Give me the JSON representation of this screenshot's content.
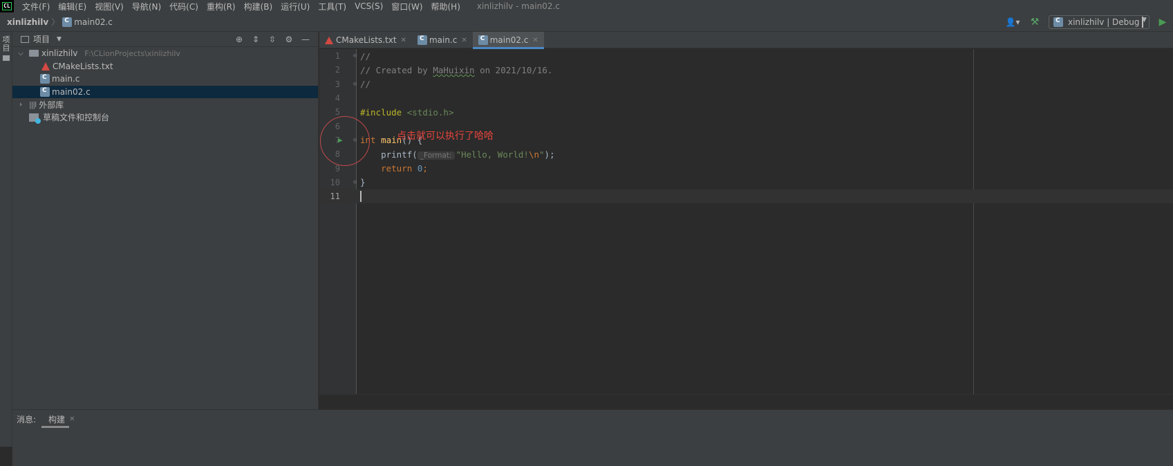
{
  "app": {
    "logo": "CL",
    "window_title": "xinlizhilv - main02.c"
  },
  "menu": [
    "文件(F)",
    "编辑(E)",
    "视图(V)",
    "导航(N)",
    "代码(C)",
    "重构(R)",
    "构建(B)",
    "运行(U)",
    "工具(T)",
    "VCS(S)",
    "窗口(W)",
    "帮助(H)"
  ],
  "breadcrumb": {
    "project": "xinlizhilv",
    "file": "main02.c"
  },
  "toolbar": {
    "config_label": "xinlizhilv | Debug",
    "icons": [
      "user-icon",
      "hammer-icon",
      "run-icon"
    ]
  },
  "toolstrip": {
    "project_tab": "项目"
  },
  "project_panel": {
    "title": "项目",
    "tree": [
      {
        "label": "xinlizhilv",
        "path": "F:\\CLionProjects\\xinlizhilv"
      },
      {
        "label": "CMakeLists.txt"
      },
      {
        "label": "main.c"
      },
      {
        "label": "main02.c"
      },
      {
        "label": "外部库"
      },
      {
        "label": "草稿文件和控制台"
      }
    ]
  },
  "tabs": [
    {
      "label": "CMakeLists.txt"
    },
    {
      "label": "main.c"
    },
    {
      "label": "main02.c"
    }
  ],
  "editor": {
    "line_numbers": [
      "1",
      "2",
      "3",
      "4",
      "5",
      "6",
      "7",
      "8",
      "9",
      "10",
      "11"
    ],
    "comment1": "//",
    "comment2_a": "// Created by ",
    "comment2_name": "MaHuixin",
    "comment2_b": " on 2021/10/16.",
    "comment3": "//",
    "include_kw": "#include",
    "include_file": " <stdio.h>",
    "int_kw": "int",
    "main_fn": "main",
    "main_rest": "() {",
    "printf_fn": "    printf(",
    "hint": "_Format:",
    "str_a": "\"Hello, World!",
    "str_esc": "\\n",
    "str_b": "\"",
    "printf_end": ");",
    "return_kw": "    return",
    "return_val": "0",
    "semicolon": ";",
    "close_brace": "}"
  },
  "annotation": {
    "text": "点击就可以执行了哈哈"
  },
  "bottom": {
    "title": "消息:",
    "tab": "构建"
  },
  "colors": {
    "accent": "#4a88c7",
    "run": "#499c54",
    "annotation": "#e8453c"
  }
}
